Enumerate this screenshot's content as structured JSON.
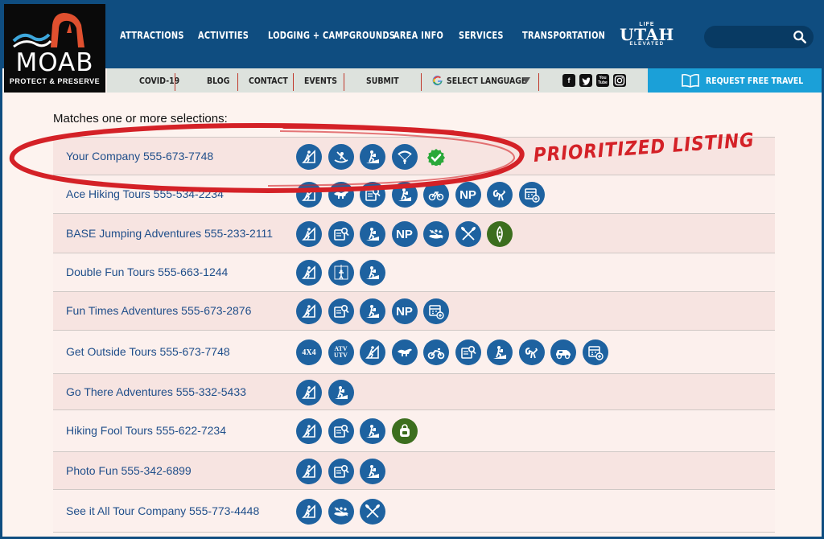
{
  "logo": {
    "word": "MOAB",
    "tagline": "PROTECT & PRESERVE"
  },
  "nav": {
    "items": [
      "ATTRACTIONS",
      "ACTIVITIES",
      "LODGING + CAMPGROUNDS",
      "AREA INFO",
      "SERVICES",
      "TRANSPORTATION"
    ]
  },
  "utah_logo": {
    "life": "LIFE",
    "name": "UTAH",
    "elevated": "ELEVATED"
  },
  "search": {
    "icon": "search-icon"
  },
  "subnav": {
    "items": [
      "COVID-19",
      "BLOG",
      "CONTACT",
      "EVENTS",
      "SUBMIT"
    ],
    "language": "SELECT LANGUAGE",
    "social": [
      "facebook-icon",
      "twitter-icon",
      "youtube-icon",
      "instagram-icon"
    ],
    "youtube_text": "You\nTube"
  },
  "request": {
    "label": "REQUEST FREE TRAVEL"
  },
  "heading": "Matches one or more selections:",
  "annotation": "PRIORITIZED LISTING",
  "colors": {
    "header": "#0f4d80",
    "icon_blue": "#1e62a0",
    "icon_green": "#3c6e1e",
    "request": "#1ba0d8",
    "annotation": "#d42127",
    "link": "#1f4e8a"
  },
  "listings": [
    {
      "name": "Your Company 555-673-7748",
      "icons": [
        "hiking",
        "rafting",
        "hiking2",
        "paragliding",
        "verified-check"
      ]
    },
    {
      "name": "Ace Hiking Tours 555-534-2234",
      "icons": [
        "hiking",
        "dinosaur",
        "guidebook",
        "hiking2",
        "bike",
        "np",
        "bighorn",
        "calendar"
      ]
    },
    {
      "name": "BASE Jumping Adventures 555-233-2111",
      "icons": [
        "hiking",
        "guidebook",
        "hiking2",
        "np",
        "rafting-group",
        "paddles",
        "canoe-green"
      ]
    },
    {
      "name": "Double Fun Tours 555-663-1244",
      "icons": [
        "hiking",
        "climbing",
        "hiking2"
      ]
    },
    {
      "name": "Fun Times Adventures 555-673-2876",
      "icons": [
        "hiking",
        "guidebook",
        "hiking2",
        "np",
        "calendar"
      ]
    },
    {
      "name": "Get Outside Tours 555-673-7748",
      "icons": [
        "4x4",
        "atv",
        "hiking",
        "dinosaur",
        "motorbike",
        "guidebook",
        "hiking2",
        "bighorn",
        "jeep",
        "calendar"
      ]
    },
    {
      "name": "Go There Adventures 555-332-5433",
      "icons": [
        "hiking",
        "hiking2"
      ]
    },
    {
      "name": "Hiking Fool Tours 555-622-7234",
      "icons": [
        "hiking",
        "guidebook",
        "hiking2",
        "backpack-green"
      ]
    },
    {
      "name": "Photo Fun 555-342-6899",
      "icons": [
        "hiking",
        "guidebook",
        "hiking2"
      ]
    },
    {
      "name": "See it All Tour Company 555-773-4448",
      "icons": [
        "hiking",
        "rafting-group",
        "paddles"
      ]
    }
  ],
  "icon_text": {
    "np": "NP",
    "4x4": "4X4",
    "atv": "ATV\nUTV"
  }
}
